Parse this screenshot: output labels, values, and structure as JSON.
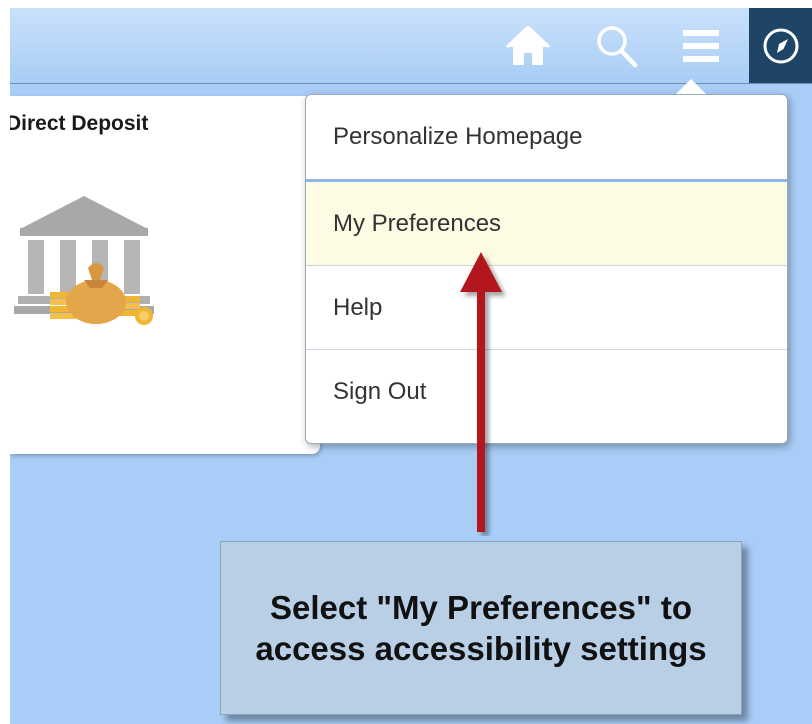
{
  "header": {
    "home_icon": "home-icon",
    "search_icon": "search-icon",
    "menu_icon": "hamburger-menu-icon",
    "nav_icon": "compass-icon",
    "nav_bg_color": "#1f4566"
  },
  "tile": {
    "title": "Direct Deposit",
    "icon": "bank-money-bag-icon"
  },
  "actions_menu": {
    "items": [
      {
        "label": "Personalize Homepage"
      },
      {
        "label": "My Preferences",
        "highlighted": true
      },
      {
        "label": "Help"
      },
      {
        "label": "Sign Out"
      }
    ]
  },
  "annotation": {
    "text": "Select \"My Preferences\" to access accessibility settings",
    "arrow_color": "#b3141c",
    "box_color": "#b9cfe6"
  },
  "colors": {
    "banner": "#a9cdf6",
    "selected_item": "#fdfbe3"
  }
}
